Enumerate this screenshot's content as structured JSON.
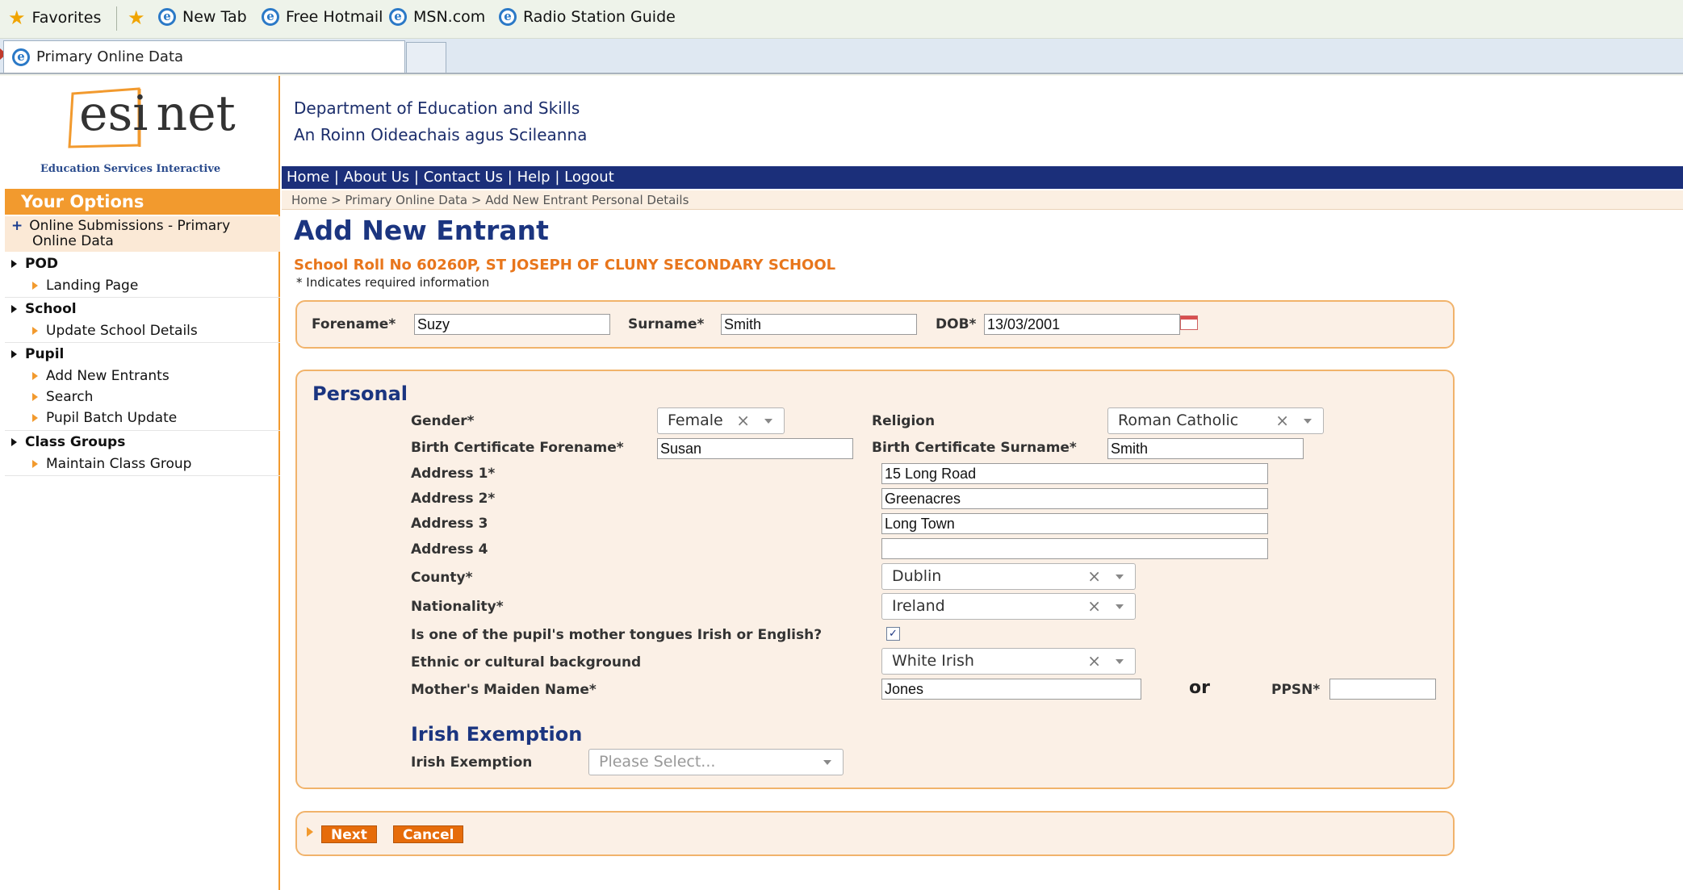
{
  "browser": {
    "favorites_label": "Favorites",
    "links": [
      "New Tab",
      "Free Hotmail",
      "MSN.com",
      "Radio Station Guide"
    ],
    "tab_title": "Primary Online Data"
  },
  "header": {
    "logo_text_a": "esi",
    "logo_text_b": "net",
    "logo_tagline": "Education Services Interactive",
    "dept_line1": "Department of Education and Skills",
    "dept_line2": "An Roinn Oideachais agus Scileanna",
    "topnav": [
      "Home",
      "About Us",
      "Contact Us",
      "Help",
      "Logout"
    ],
    "breadcrumb": "Home > Primary Online Data > Add New Entrant Personal Details"
  },
  "sidebar": {
    "header": "Your Options",
    "online_submissions_line1": "Online Submissions - Primary",
    "online_submissions_line2": "Online Data",
    "pod": "POD",
    "landing_page": "Landing Page",
    "school": "School",
    "update_school_details": "Update School Details",
    "pupil": "Pupil",
    "add_new_entrants": "Add New Entrants",
    "search": "Search",
    "pupil_batch_update": "Pupil Batch Update",
    "class_groups": "Class Groups",
    "maintain_class_group": "Maintain Class Group"
  },
  "main": {
    "title": "Add New Entrant",
    "school_roll": "School Roll No 60260P, ST JOSEPH OF CLUNY SECONDARY SCHOOL",
    "required_note": "* Indicates required information",
    "basic": {
      "forename_label": "Forename*",
      "forename_value": "Suzy",
      "surname_label": "Surname*",
      "surname_value": "Smith",
      "dob_label": "DOB*",
      "dob_value": "13/03/2001"
    },
    "personal": {
      "title": "Personal",
      "gender_label": "Gender*",
      "gender_value": "Female",
      "religion_label": "Religion",
      "religion_value": "Roman Catholic",
      "bc_forename_label": "Birth Certificate Forename*",
      "bc_forename_value": "Susan",
      "bc_surname_label": "Birth Certificate Surname*",
      "bc_surname_value": "Smith",
      "address1_label": "Address 1*",
      "address1_value": "15 Long Road",
      "address2_label": "Address 2*",
      "address2_value": "Greenacres",
      "address3_label": "Address 3",
      "address3_value": "Long Town",
      "address4_label": "Address 4",
      "address4_value": "",
      "county_label": "County*",
      "county_value": "Dublin",
      "nationality_label": "Nationality*",
      "nationality_value": "Ireland",
      "mother_tongue_label": "Is one of the pupil's mother tongues Irish or English?",
      "mother_tongue_checked": true,
      "ethnic_label": "Ethnic or cultural background",
      "ethnic_value": "White Irish",
      "maiden_label": "Mother's Maiden Name*",
      "maiden_value": "Jones",
      "or_text": "or",
      "ppsn_label": "PPSN*",
      "ppsn_value": ""
    },
    "irish": {
      "title": "Irish Exemption",
      "label": "Irish Exemption",
      "placeholder": "Please Select..."
    },
    "buttons": {
      "next": "Next",
      "cancel": "Cancel"
    }
  },
  "icons": {
    "x_glyph": "×",
    "check_glyph": "✓"
  }
}
